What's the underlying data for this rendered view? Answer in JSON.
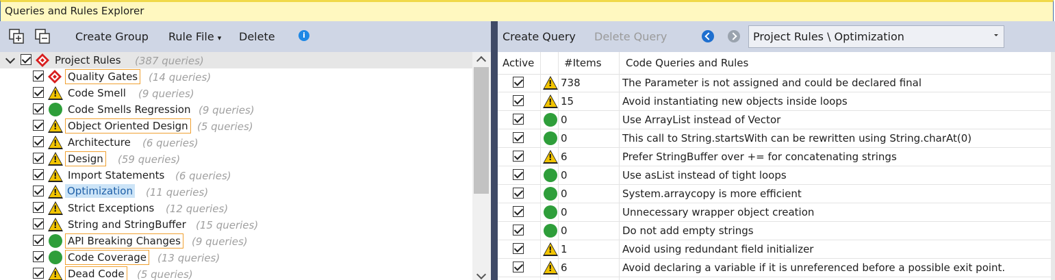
{
  "window": {
    "title": "Queries and Rules Explorer"
  },
  "left_toolbar": {
    "buttons": [
      "Create Group",
      "Rule File",
      "Delete"
    ],
    "rule_file_caret": "▾",
    "info_glyph": "i"
  },
  "tree": {
    "root": {
      "label": "Project Rules",
      "count": "(387 queries)",
      "icon": "quality-gates-icon"
    },
    "items": [
      {
        "label": "Quality Gates",
        "count": "(14 queries)",
        "icon": "quality-gates-icon",
        "status": "diamond",
        "boxed": true
      },
      {
        "label": "Code Smell",
        "count": "(9 queries)",
        "icon": "warning-icon",
        "status": "warning",
        "boxed": false
      },
      {
        "label": "Code Smells Regression",
        "count": "(9 queries)",
        "icon": "ok-icon",
        "status": "ok",
        "boxed": false
      },
      {
        "label": "Object Oriented Design",
        "count": "(5 queries)",
        "icon": "warning-icon",
        "status": "warning",
        "boxed": true
      },
      {
        "label": "Architecture",
        "count": "(6 queries)",
        "icon": "warning-icon",
        "status": "warning",
        "boxed": false
      },
      {
        "label": "Design",
        "count": "(59 queries)",
        "icon": "warning-icon",
        "status": "warning",
        "boxed": true
      },
      {
        "label": "Import Statements",
        "count": "(6 queries)",
        "icon": "warning-icon",
        "status": "warning",
        "boxed": false
      },
      {
        "label": "Optimization",
        "count": "(11 queries)",
        "icon": "warning-icon",
        "status": "warning",
        "selected": true
      },
      {
        "label": "Strict Exceptions",
        "count": "(12 queries)",
        "icon": "warning-icon",
        "status": "warning",
        "boxed": false
      },
      {
        "label": "String and StringBuffer",
        "count": "(15 queries)",
        "icon": "warning-icon",
        "status": "warning",
        "boxed": false
      },
      {
        "label": "API Breaking Changes",
        "count": "(9 queries)",
        "icon": "ok-icon",
        "status": "ok",
        "boxed": true
      },
      {
        "label": "Code Coverage",
        "count": "(13 queries)",
        "icon": "ok-icon",
        "status": "ok",
        "boxed": true
      },
      {
        "label": "Dead Code",
        "count": "(5 queries)",
        "icon": "warning-icon",
        "status": "warning",
        "boxed": true
      }
    ]
  },
  "right_toolbar": {
    "create_query": "Create Query",
    "delete_query": "Delete Query",
    "group_select": "Project Rules \\ Optimization"
  },
  "grid": {
    "headers": {
      "active": "Active",
      "items": "#Items",
      "name": "Code Queries and Rules"
    },
    "rows": [
      {
        "status": "warning",
        "items": "738",
        "name": "The Parameter is not assigned and could be declared final"
      },
      {
        "status": "warning",
        "items": "15",
        "name": "Avoid instantiating new objects inside loops"
      },
      {
        "status": "ok",
        "items": "0",
        "name": "Use ArrayList instead of Vector"
      },
      {
        "status": "ok",
        "items": "0",
        "name": "This call to String.startsWith can be rewritten using String.charAt(0)"
      },
      {
        "status": "warning",
        "items": "6",
        "name": "Prefer StringBuffer over += for concatenating strings"
      },
      {
        "status": "ok",
        "items": "0",
        "name": "Use asList instead of tight loops"
      },
      {
        "status": "ok",
        "items": "0",
        "name": "System.arraycopy is more efficient"
      },
      {
        "status": "ok",
        "items": "0",
        "name": "Unnecessary wrapper object creation"
      },
      {
        "status": "ok",
        "items": "0",
        "name": "Do not add empty strings"
      },
      {
        "status": "warning",
        "items": "1",
        "name": "Avoid using redundant field initializer"
      },
      {
        "status": "warning",
        "items": "6",
        "name": "Avoid declaring a variable if it is unreferenced before a possible exit point."
      }
    ]
  },
  "colors": {
    "warning": "#f2c400",
    "ok": "#2e9e3a",
    "selected_bg": "#cce4f7",
    "group_box": "#f0a030"
  }
}
